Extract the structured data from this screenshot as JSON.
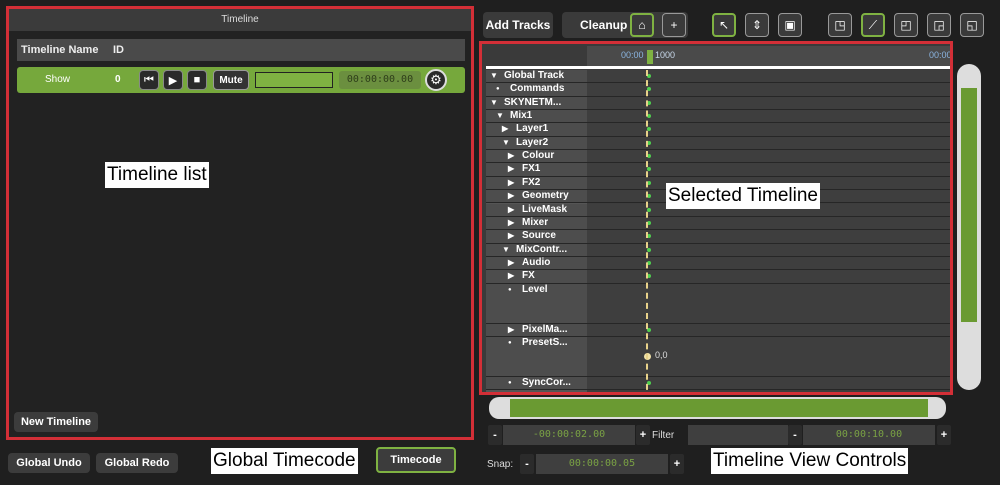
{
  "left_panel": {
    "title": "Timeline",
    "columns": [
      "Timeline Name",
      "ID"
    ],
    "timelines": [
      {
        "name": "Show",
        "id": "0",
        "mute_label": "Mute",
        "timecode": "00:00:00.00"
      }
    ],
    "new_timeline_label": "New Timeline"
  },
  "callouts": {
    "timeline_list": "Timeline list",
    "selected_timeline": "Selected Timeline",
    "global_timecode": "Global Timecode",
    "timeline_view_controls": "Timeline View Controls"
  },
  "bottom_bar": {
    "global_undo": "Global Undo",
    "global_redo": "Global Redo",
    "timecode": "Timecode"
  },
  "toolbar": {
    "add_tracks": "Add Tracks",
    "cleanup": "Cleanup"
  },
  "ruler": {
    "labels": [
      "00:00",
      "1000",
      "00:00"
    ]
  },
  "tracks": [
    {
      "label": "Global Track",
      "indent": 0,
      "marker": "expanded"
    },
    {
      "label": "Commands",
      "indent": 1,
      "marker": "dot"
    },
    {
      "label": "SKYNETM...",
      "indent": 0,
      "marker": "expanded"
    },
    {
      "label": "Mix1",
      "indent": 1,
      "marker": "expanded"
    },
    {
      "label": "Layer1",
      "indent": 2,
      "marker": "collapsed"
    },
    {
      "label": "Layer2",
      "indent": 2,
      "marker": "expanded"
    },
    {
      "label": "Colour",
      "indent": 3,
      "marker": "collapsed"
    },
    {
      "label": "FX1",
      "indent": 3,
      "marker": "collapsed"
    },
    {
      "label": "FX2",
      "indent": 3,
      "marker": "collapsed"
    },
    {
      "label": "Geometry",
      "indent": 3,
      "marker": "collapsed"
    },
    {
      "label": "LiveMask",
      "indent": 3,
      "marker": "collapsed"
    },
    {
      "label": "Mixer",
      "indent": 3,
      "marker": "collapsed"
    },
    {
      "label": "Source",
      "indent": 3,
      "marker": "collapsed"
    },
    {
      "label": "MixContr...",
      "indent": 2,
      "marker": "expanded"
    },
    {
      "label": "Audio",
      "indent": 3,
      "marker": "collapsed"
    },
    {
      "label": "FX",
      "indent": 3,
      "marker": "collapsed"
    },
    {
      "label": "Level",
      "indent": 3,
      "marker": "dot"
    },
    {
      "label": "PixelMa...",
      "indent": 3,
      "marker": "collapsed"
    },
    {
      "label": "PresetS...",
      "indent": 3,
      "marker": "dot"
    },
    {
      "label": "SyncCor...",
      "indent": 3,
      "marker": "dot"
    }
  ],
  "keyframe_value": "0,0",
  "view_controls": {
    "start_time": "-00:00:02.00",
    "filter_label": "Filter",
    "filter_value": "",
    "end_time": "00:00:10.00",
    "snap_label": "Snap:",
    "snap_value": "00:00:00.05"
  },
  "colors": {
    "accent_green": "#7fb242",
    "callout_border": "#d32f37",
    "playhead": "#e8d28a"
  }
}
